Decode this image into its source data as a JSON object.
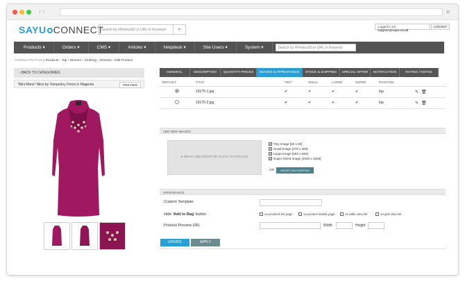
{
  "header": {
    "logo_prefix": "SAYU",
    "logo_suffix": "CONNECT",
    "search_placeholder": "Search by #ProductID or URL or Keyword",
    "logged_in_label": "Logged in as:",
    "logged_in_email": "support@sayu.co.uk",
    "logout_label": "LOGOUT"
  },
  "nav": {
    "items": [
      "Products ▾",
      "Orders ▾",
      "CMS ▾",
      "Articles ▾",
      "Helpdesk ▾",
      "Site Users ▾",
      "System ▾"
    ],
    "search_placeholder": "Search by #ProductID or URL or Keyword"
  },
  "breadcrumb": [
    "ADMINISTRATION",
    "Products",
    "Top",
    "Women",
    "Clothing",
    "Dresses",
    "Edit Product"
  ],
  "left": {
    "back_label": "BACK TO CATEGORIES",
    "product_name": "\"Mini Marie\" Alice by Temperley Dress in Magenta",
    "preview_label": "PREVIEW"
  },
  "tabs": [
    "GENERAL",
    "DESCRIPTION",
    "QUANTITY PRICES",
    "IMAGES & APPEARANCE",
    "STOCK & SHIPPING",
    "SPECIAL OFFER",
    "NOTIFICATION",
    "RATING / NOTES"
  ],
  "active_tab": "IMAGES & APPEARANCE",
  "images_table": {
    "columns": [
      "DEFAULT",
      "TITLE",
      "TINY",
      "SMALL",
      "LARGE",
      "SUPER",
      "POSITION"
    ],
    "rows": [
      {
        "default": true,
        "title": "19175-1.jpg",
        "tiny": "✔",
        "small": "✔",
        "large": "✔",
        "super": "✔",
        "position": "top"
      },
      {
        "default": false,
        "title": "19175-2.jpg",
        "tiny": "✔",
        "small": "✔",
        "large": "✔",
        "super": "✔",
        "position": "top"
      }
    ]
  },
  "add_images": {
    "header": "ADD NEW IMAGES",
    "dropzone": "● DRAG AND DROP OR CLICK TO UPLOAD",
    "sizes": [
      "Tiny Image [50 x 50]",
      "Small Image [275 x 320]",
      "Large Image [562 x 655]",
      "Super-Sized Image [1000 x 1000]"
    ],
    "or_label": "OR",
    "select_existing": "SELECT AN EXISTING IMAGE"
  },
  "appearance": {
    "header": "APPEARANCE",
    "custom_template": "Custom Template",
    "hide_bag_prefix": "Hide '",
    "hide_bag_bold": "Add to Bag",
    "hide_bag_suffix": "' button",
    "hide_options": [
      "on products list page",
      "on product details page",
      "on table view list",
      "on grid view list"
    ],
    "preview_url": "Product Preview URL",
    "width_label": "Width",
    "height_label": "Height"
  },
  "buttons": {
    "update": "UPDATE",
    "apply": "APPLY"
  },
  "colors": {
    "accent": "#2a9fd6",
    "nav": "#535353",
    "dress": "#a0185f"
  }
}
